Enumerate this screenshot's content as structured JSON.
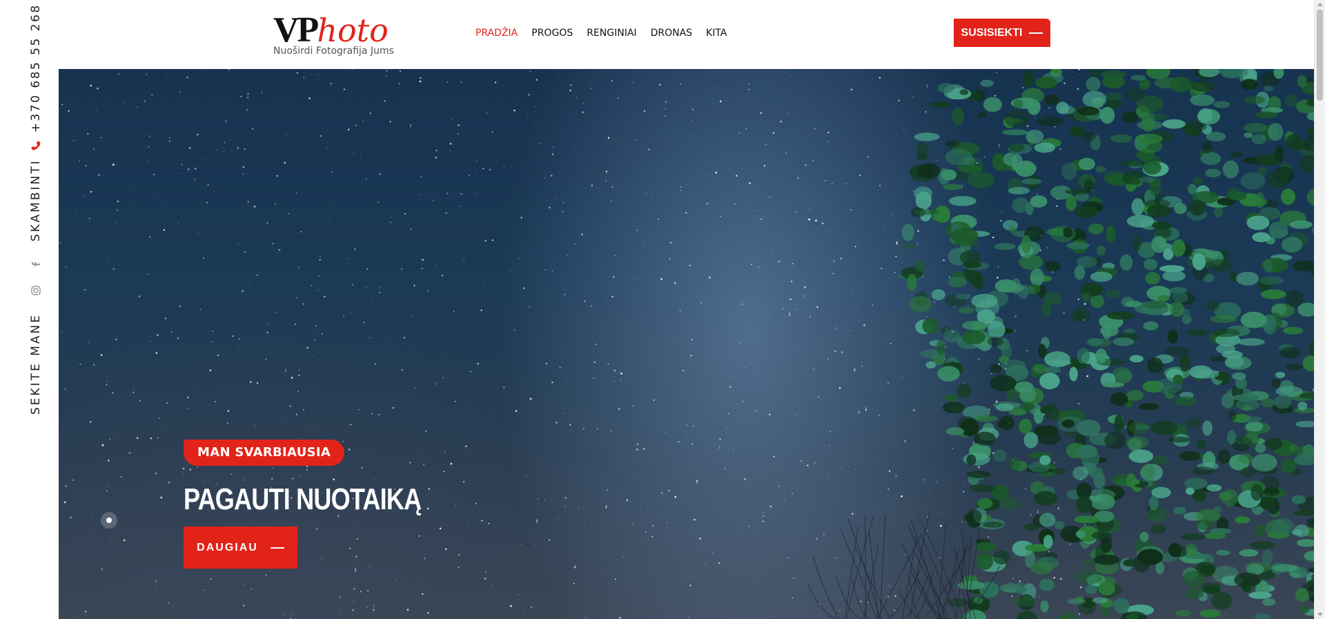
{
  "rail": {
    "follow_label": "SEKITE MANE",
    "icons": [
      "instagram-icon",
      "facebook-icon",
      "phone-icon"
    ],
    "call_label": "SKAMBINTI",
    "phone": "+370 685 55 268"
  },
  "header": {
    "logo_vp": "VP",
    "logo_photo": "hoto",
    "tagline": "Nuoširdi Fotografija Jums",
    "nav": [
      {
        "label": "PRADŽIA",
        "active": true
      },
      {
        "label": "PROGOS",
        "active": false
      },
      {
        "label": "RENGINIAI",
        "active": false
      },
      {
        "label": "DRONAS",
        "active": false
      },
      {
        "label": "KITA",
        "active": false
      }
    ],
    "cta_label": "SUSISIEKTI"
  },
  "hero": {
    "badge": "MAN SVARBIAUSIA",
    "title": "PAGAUTI NUOTAIKĄ",
    "button_label": "DAUGIAU"
  },
  "colors": {
    "accent": "#e2231a",
    "text": "#111111",
    "sky_top": "#163350",
    "foliage": "#1f5a2c"
  }
}
